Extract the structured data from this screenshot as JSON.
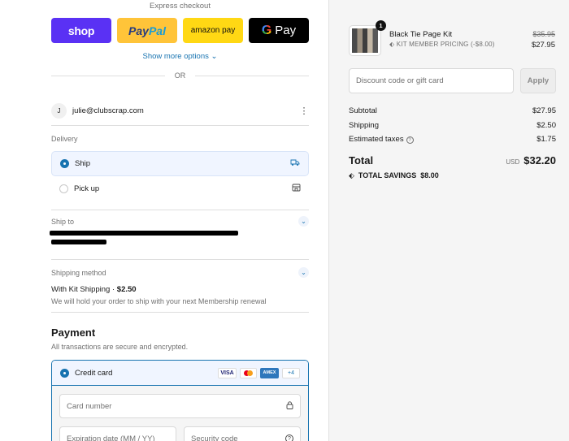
{
  "express": {
    "title": "Express checkout",
    "shop_label": "shop",
    "paypal_pay": "Pay",
    "paypal_pal": "Pal",
    "amazon_label": "amazon pay",
    "gpay_g": "G",
    "gpay_label": "Pay",
    "show_more": "Show more options ⌄",
    "or": "OR"
  },
  "account": {
    "avatar_initial": "J",
    "email": "julie@clubscrap.com",
    "menu_icon": "⋮"
  },
  "delivery": {
    "label": "Delivery",
    "options": [
      {
        "label": "Ship",
        "selected": true,
        "icon": "truck-icon"
      },
      {
        "label": "Pick up",
        "selected": false,
        "icon": "store-icon"
      }
    ]
  },
  "ship_to": {
    "label": "Ship to"
  },
  "shipping_method": {
    "label": "Shipping method",
    "name": "With Kit Shipping",
    "separator": "·",
    "price": "$2.50",
    "note": "We will hold your order to ship with your next Membership renewal"
  },
  "payment": {
    "title": "Payment",
    "subtitle": "All transactions are secure and encrypted.",
    "method_label": "Credit card",
    "brands": {
      "visa": "VISA",
      "amex": "AMEX",
      "more": "+4"
    },
    "card_number_placeholder": "Card number",
    "expiration_placeholder": "Expiration date (MM / YY)",
    "security_placeholder": "Security code"
  },
  "summary": {
    "item": {
      "quantity": "1",
      "name": "Black Tie Page Kit",
      "discount": "KIT MEMBER PRICING (-$8.00)",
      "original_price": "$35.95",
      "price": "$27.95"
    },
    "discount_placeholder": "Discount code or gift card",
    "apply_label": "Apply",
    "subtotal_label": "Subtotal",
    "subtotal": "$27.95",
    "shipping_label": "Shipping",
    "shipping": "$2.50",
    "taxes_label": "Estimated taxes",
    "taxes": "$1.75",
    "total_label": "Total",
    "currency": "USD",
    "total": "$32.20",
    "savings_label": "TOTAL SAVINGS",
    "savings": "$8.00"
  },
  "colors": {
    "accent": "#1773b0",
    "shop": "#5a31f4",
    "paypal": "#ffc439",
    "amazon": "#ffd814"
  }
}
